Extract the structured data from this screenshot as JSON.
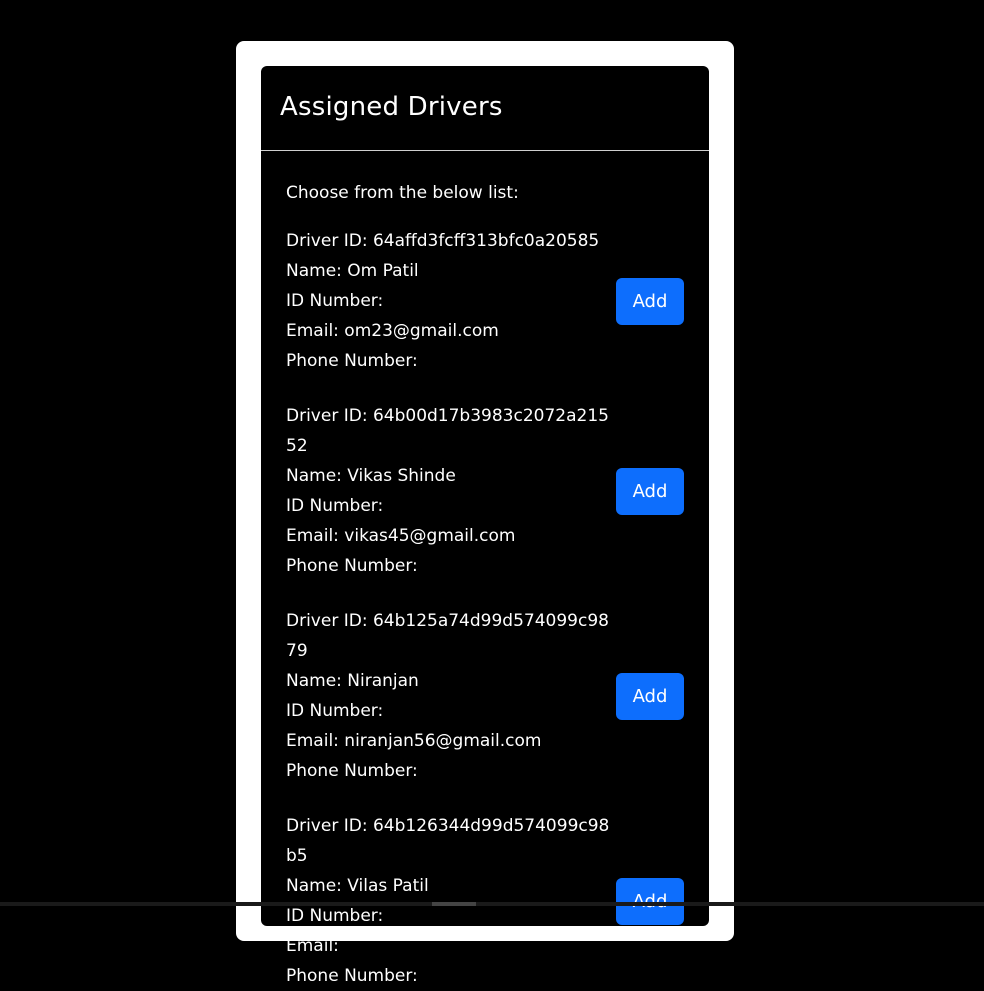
{
  "card": {
    "title": "Assigned Drivers",
    "intro": "Choose from the below list:"
  },
  "add_label": "Add",
  "drivers": [
    {
      "id_line": "Driver ID: 64affd3fcff313bfc0a20585",
      "name_line": "Name: Om Patil",
      "idnum_line": "ID Number:",
      "email_line": "Email: om23@gmail.com",
      "phone_line": "Phone Number:"
    },
    {
      "id_line": "Driver ID: 64b00d17b3983c2072a21552",
      "name_line": "Name: Vikas Shinde",
      "idnum_line": "ID Number:",
      "email_line": "Email: vikas45@gmail.com",
      "phone_line": "Phone Number:"
    },
    {
      "id_line": "Driver ID: 64b125a74d99d574099c9879",
      "name_line": "Name: Niranjan",
      "idnum_line": "ID Number:",
      "email_line": "Email: niranjan56@gmail.com",
      "phone_line": "Phone Number:"
    },
    {
      "id_line": "Driver ID: 64b126344d99d574099c98b5",
      "name_line": "Name: Vilas Patil",
      "idnum_line": "ID Number:",
      "email_line": "Email:",
      "phone_line": "Phone Number:"
    }
  ]
}
